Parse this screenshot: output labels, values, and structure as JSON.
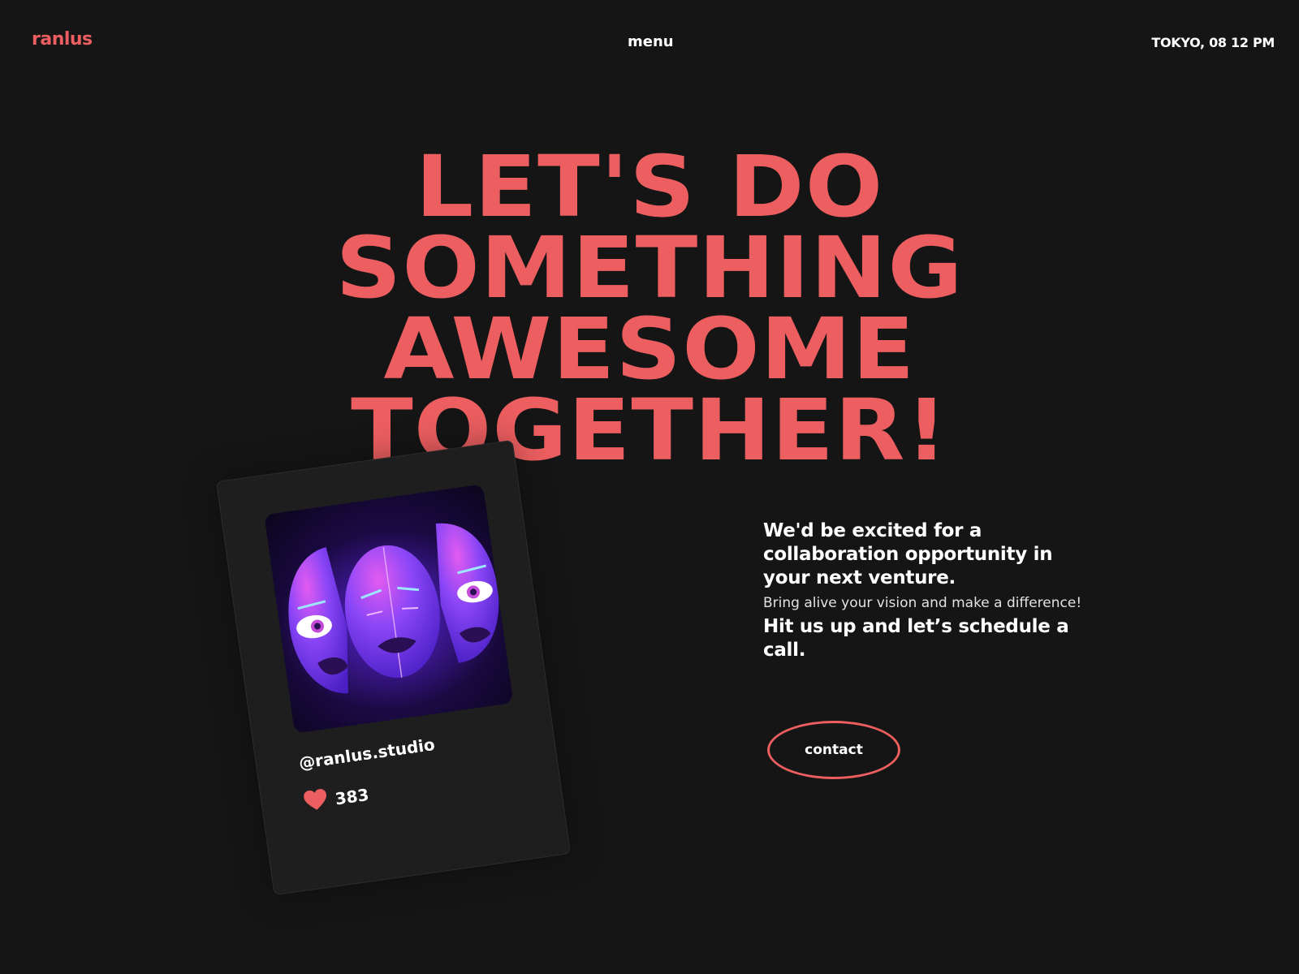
{
  "header": {
    "logo": "ranlus",
    "menu_label": "menu",
    "clock": "TOKYO, 08 12 PM"
  },
  "hero": {
    "headline_lines": [
      "LET'S DO",
      "SOMETHING",
      "AWESOME",
      "TOGETHER!"
    ]
  },
  "card": {
    "handle": "@ranlus.studio",
    "likes": "383",
    "art_icon": "three-purple-faces-illustration",
    "like_icon": "heart-icon"
  },
  "pitch": {
    "lead": "We'd be excited for a collaboration opportunity in your next venture.",
    "sub": "Bring alive your vision and make a difference!",
    "cta": "Hit us up and let’s schedule a call."
  },
  "contact_button": "contact",
  "colors": {
    "background": "#151515",
    "accent": "#ec5e60",
    "card_bg": "#1e1e1e",
    "text": "#ffffff",
    "art_purple": "#7a3cf5",
    "art_pink": "#e25bf0"
  }
}
